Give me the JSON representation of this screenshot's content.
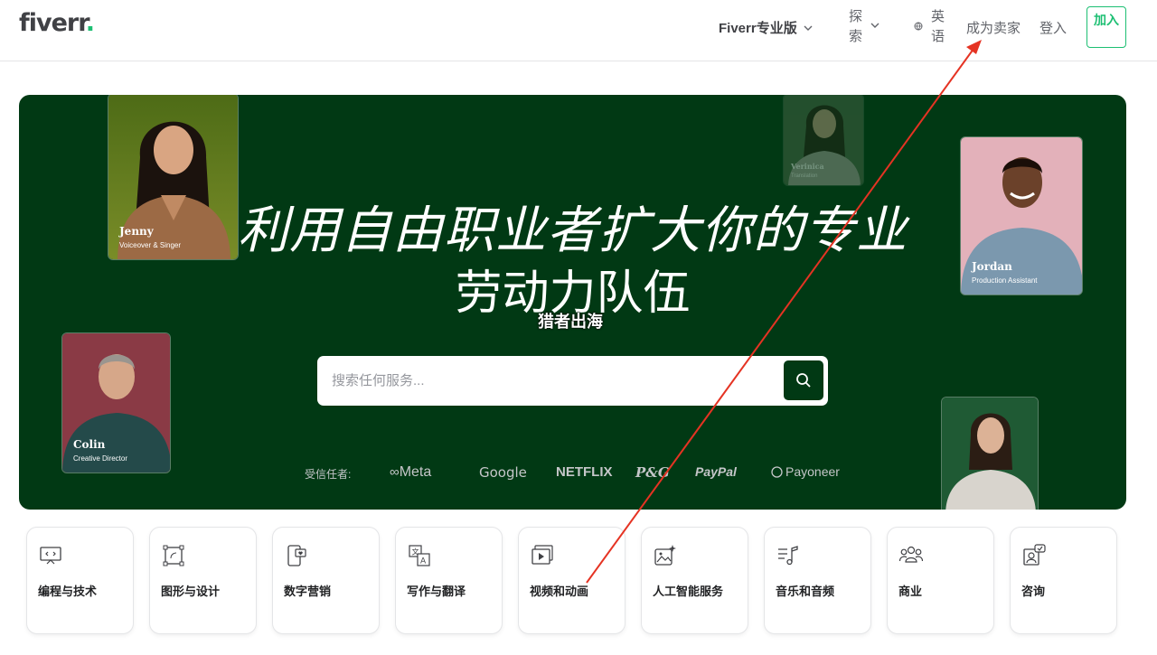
{
  "header": {
    "logo_text": "fiverr",
    "logo_dot": ".",
    "pro_label": "Fiverr专业版",
    "explore_label": "探索",
    "language_label": "英语",
    "become_seller_label": "成为卖家",
    "login_label": "登入",
    "join_label": "加入"
  },
  "hero": {
    "headline_line1": "利用自由职业者扩大你的专业",
    "headline_line2": "劳动力队伍",
    "watermark": "猎者出海",
    "search_placeholder": "搜索任何服务...",
    "trusted_label": "受信任者:",
    "brands": [
      "Meta",
      "Google",
      "NETFLIX",
      "P&G",
      "PayPal",
      "Payoneer"
    ],
    "freelancers": [
      {
        "name": "Jenny",
        "role": "Voiceover & Singer"
      },
      {
        "name": "Verinica",
        "role": "Translation"
      },
      {
        "name": "Jordan",
        "role": "Production Assistant"
      },
      {
        "name": "Colin",
        "role": "Creative Director"
      }
    ]
  },
  "categories": [
    {
      "label": "编程与技术",
      "icon": "code-monitor-icon"
    },
    {
      "label": "图形与设计",
      "icon": "design-frame-icon"
    },
    {
      "label": "数字营销",
      "icon": "phone-heart-icon"
    },
    {
      "label": "写作与翻译",
      "icon": "translate-icon"
    },
    {
      "label": "视频和动画",
      "icon": "video-play-icon"
    },
    {
      "label": "人工智能服务",
      "icon": "ai-image-icon"
    },
    {
      "label": "音乐和音频",
      "icon": "music-note-icon"
    },
    {
      "label": "商业",
      "icon": "people-group-icon"
    },
    {
      "label": "咨询",
      "icon": "consult-chat-icon"
    }
  ],
  "colors": {
    "brand_green": "#1dbf73",
    "hero_bg": "#013914",
    "annotation_arrow": "#e53323"
  }
}
